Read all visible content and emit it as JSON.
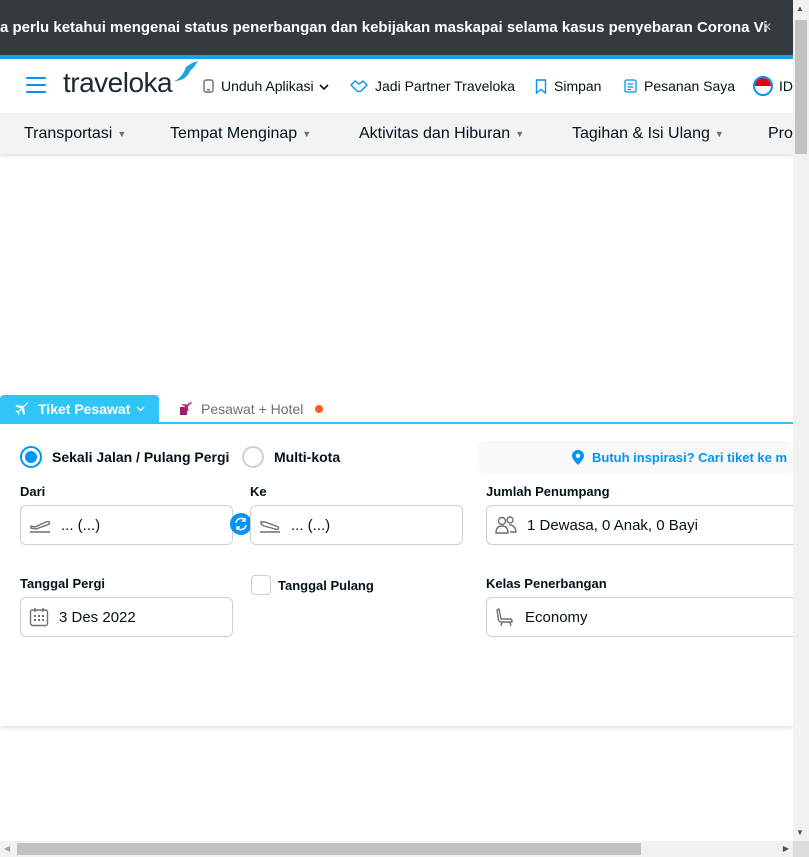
{
  "announcement": {
    "text": "a perlu ketahui mengenai status penerbangan dan kebijakan maskapai selama kasus penyebaran Corona Vi"
  },
  "header": {
    "logo": "traveloka",
    "download_app": "Unduh Aplikasi",
    "partner": "Jadi Partner Traveloka",
    "saved": "Simpan",
    "my_orders": "Pesanan Saya",
    "language": "ID"
  },
  "categories": [
    {
      "label": "Transportasi"
    },
    {
      "label": "Tempat Menginap"
    },
    {
      "label": "Aktivitas dan Hiburan"
    },
    {
      "label": "Tagihan & Isi Ulang"
    },
    {
      "label": "Pro"
    }
  ],
  "tabs": {
    "flight": "Tiket Pesawat",
    "flight_hotel": "Pesawat + Hotel"
  },
  "trip_type": {
    "oneway_round": "Sekali Jalan / Pulang Pergi",
    "multicity": "Multi-kota",
    "selected": "oneway_round"
  },
  "inspiration": "Butuh inspirasi? Cari tiket ke m",
  "form": {
    "from_label": "Dari",
    "from_value": "... (...)",
    "to_label": "Ke",
    "to_value": "... (...)",
    "passengers_label": "Jumlah Penumpang",
    "passengers_value": "1 Dewasa, 0 Anak, 0 Bayi",
    "depart_label": "Tanggal Pergi",
    "depart_value": "3 Des 2022",
    "return_label": "Tanggal Pulang",
    "return_checked": false,
    "class_label": "Kelas Penerbangan",
    "class_value": "Economy"
  },
  "colors": {
    "primary": "#0194f3",
    "tab_active": "#30c5f7",
    "announcement_bg": "#353a3f",
    "accent_orange": "#ff5e1f"
  }
}
